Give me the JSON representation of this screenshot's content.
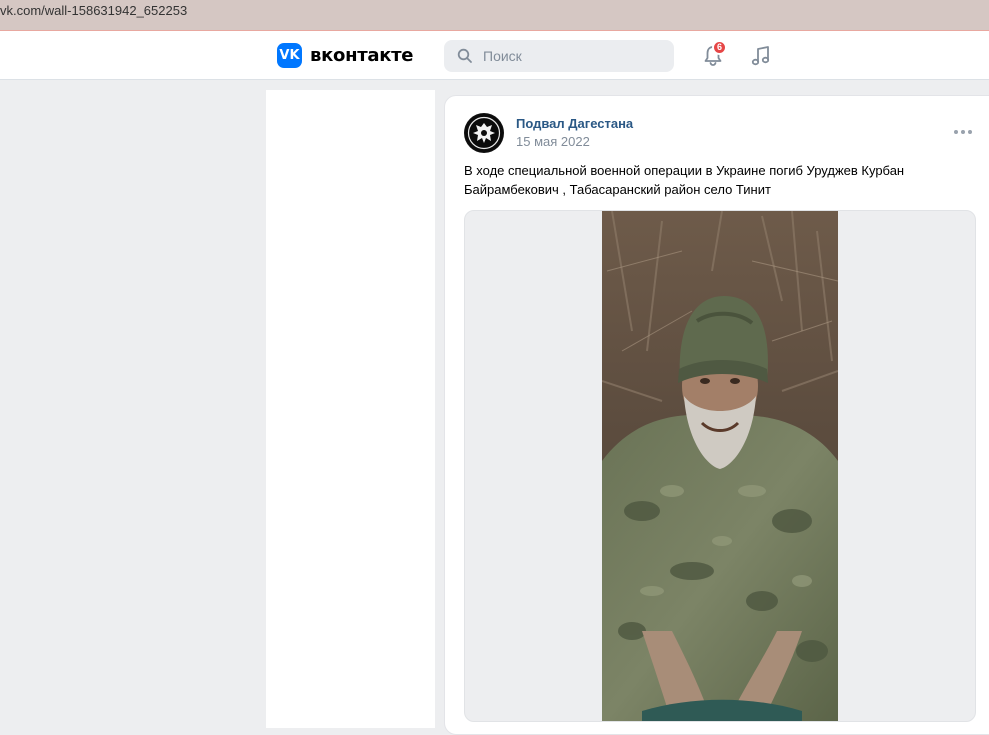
{
  "browser": {
    "url": "vk.com/wall-158631942_652253"
  },
  "header": {
    "logo_badge": "VK",
    "logo_text": "вконтакте",
    "search_placeholder": "Поиск",
    "notifications_count": "6",
    "icons": [
      "vk-logo-icon",
      "search-icon",
      "bell-icon",
      "music-icon"
    ]
  },
  "post": {
    "author": "Подвал Дагестана",
    "date": "15 мая 2022",
    "text": "В ходе специальной военной операции в Украине погиб Уруджев Курбан Байрамбекович , Табасаранский район село Тинит",
    "icons": [
      "more-icon"
    ],
    "photo": "photo of a smiling bearded man in a green knit cap and camouflage jacket"
  },
  "colors": {
    "accent": "#0077ff",
    "link": "#2a5885",
    "badge": "#e64646",
    "background": "#edeef0"
  }
}
